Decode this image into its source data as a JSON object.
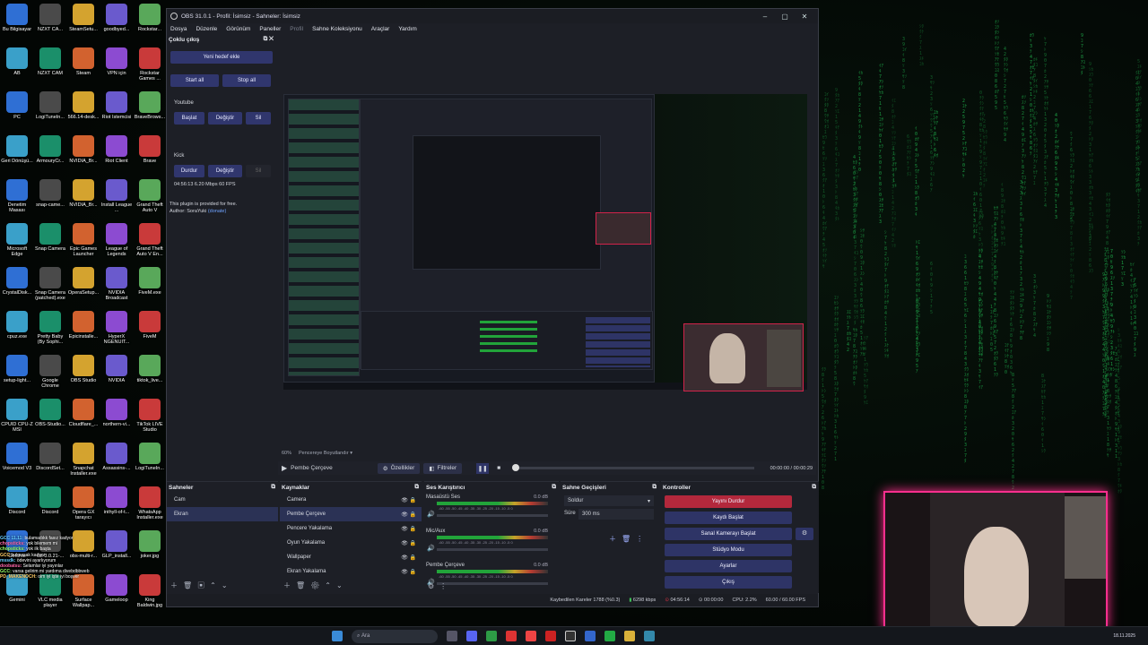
{
  "obs": {
    "title": "OBS 31.0.1 - Profil: İsimsiz - Sahneler: İsimsiz",
    "menu": [
      "Dosya",
      "Düzenle",
      "Görünüm",
      "Paneller",
      "Profil",
      "Sahne Koleksiyonu",
      "Araçlar",
      "Yardım"
    ],
    "multi_output": {
      "title": "Çoklu çıkış",
      "add_target": "Yeni hedef ekle",
      "start_all": "Start all",
      "stop_all": "Stop all",
      "youtube": {
        "name": "Youtube",
        "start": "Başlat",
        "change": "Değiştir",
        "delete": "Sil"
      },
      "kick": {
        "name": "Kick",
        "stop": "Durdur",
        "change": "Değiştir",
        "delete": "Sil",
        "stats": "04:56:13  6.20 Mbps  60 FPS"
      },
      "free_note": "This plugin is provided for free.",
      "author": "Author: SoraYuki",
      "donate": "(donate)"
    },
    "scale_label": "60%",
    "scale_mode": "Pencereye Boyutlandır",
    "source_bar": {
      "scene": "Pembe Çerçeve",
      "props": "Özellikler",
      "filters": "Filtreler",
      "time": "00:00:00 / 00:00:29"
    },
    "scenes": {
      "title": "Sahneler",
      "items": [
        "Cam",
        "Ekran"
      ],
      "selected": 1
    },
    "sources": {
      "title": "Kaynaklar",
      "items": [
        "Camera",
        "Pembe Çerçeve",
        "Pencere Yakalama",
        "Oyun Yakalama",
        "Wallpaper",
        "Ekran Yakalama"
      ],
      "selected": 1
    },
    "mixer": {
      "title": "Ses Karıştırıcı",
      "channels": [
        {
          "name": "Masaüstü Ses",
          "db": "0.0 dB"
        },
        {
          "name": "Mic/Aux",
          "db": "0.0 dB"
        },
        {
          "name": "Pembe Çerçeve",
          "db": "0.0 dB"
        }
      ],
      "scale": "-60 -55 -50 -45 -40 -35 -30 -25 -20 -15 -10 -5 0"
    },
    "transitions": {
      "title": "Sahne Geçişleri",
      "type": "Soldur",
      "duration_label": "Süre",
      "duration": "300 ms"
    },
    "controls": {
      "title": "Kontroller",
      "stop_stream": "Yayını Durdur",
      "start_record": "Kaydı Başlat",
      "virtual_cam": "Sanal Kamerayı Başlat",
      "studio": "Stüdyo Modu",
      "settings": "Ayarlar",
      "exit": "Çıkış"
    },
    "status": {
      "dropped": "Kaybedilen Kareler 1788 (%0.3)",
      "kbps": "6298 kbps",
      "live": "04:56:14",
      "rec": "00:00:00",
      "cpu": "CPU: 2.2%",
      "fps": "60.00 / 60.00 FPS"
    }
  },
  "desktop_icons": [
    "Bu Bilgisayar",
    "NZXT CA...",
    "SteamSetu...",
    "goodbyed...",
    "Rockstar...",
    "AB",
    "NZXT CAM",
    "Steam",
    "VPN için",
    "Rockstar Games ...",
    "PC",
    "LogiTuneIn...",
    "566.14-desk...",
    "Riot İstemcisi",
    "BraveBrows...",
    "Geri Dönüşü...",
    "ArmouryCr...",
    "NVIDIA_Br...",
    "Riot Client",
    "Brave",
    "Denetim Masası",
    "snap-came...",
    "NVIDIA_Br...",
    "Install League ...",
    "Grand Theft Auto V",
    "Microsoft Edge",
    "Snap Camera",
    "Epic Games Launcher",
    "League of Legends",
    "Grand Theft Auto V En...",
    "CrystalDisk...",
    "Snap Camera (patched).exe",
    "OperaSetup...",
    "NVIDIA Broadcast",
    "FiveM.exe",
    "cpuz.exe",
    "Pretty Baby (By Sophi...",
    "Epicinstalle...",
    "HyperX NGENUIT...",
    "FiveM",
    "setup-light...",
    "Google Chrome",
    "OBS Studio",
    "NVIDIA",
    "tiktok_live...",
    "CPUID CPU-Z MSI",
    "OBS-Studio...",
    "Cloudflare_...",
    "northern-vi...",
    "TikTok LIVE Studio",
    "Voicemod V3",
    "DiscordSet...",
    "Snapchat Installer.exe",
    "Assassins-...",
    "LogiTuneIn...",
    "Discord",
    "Discord",
    "Opera GX tarayıcı",
    "inthyll-of-t...",
    "WhatsApp Installer.exe",
    "Geforce",
    "vlc-3.0.21-...",
    "obs-multi-r...",
    "GLP_install...",
    "joker.jpg",
    "Gemini",
    "VLC media player",
    "Surface Wallpap...",
    "Gameloop",
    "King Baldwin.jpg"
  ],
  "chat": [
    {
      "n": "GCC 11.11:",
      "t": "bulamadıkk fasız kadyor"
    },
    {
      "n": "chopsticks:",
      "t": "yok bilemem mi"
    },
    {
      "n": "chopsticks:",
      "t": "yok ilk başta"
    },
    {
      "n": "GCC",
      "t": "bulmasak kadyor"
    },
    {
      "n": "mssdk:",
      "t": "ödevini ayarlıyorum"
    },
    {
      "n": "doobatsu:",
      "t": "Selamlar iyi yayınlar"
    },
    {
      "n": "GCC:",
      "t": "varsa gelirim mi yardıma divebdbbweb"
    },
    {
      "n": "PD_MAKENOCH:",
      "t": "olm iyi işte iyi boşver"
    }
  ],
  "taskbar": {
    "search": "Ara",
    "date": "18.11.2025"
  },
  "colors": {
    "accent": "#30366d",
    "danger": "#b3283c",
    "pink": "#ff2f8e",
    "matrix": "#1fae4b"
  }
}
